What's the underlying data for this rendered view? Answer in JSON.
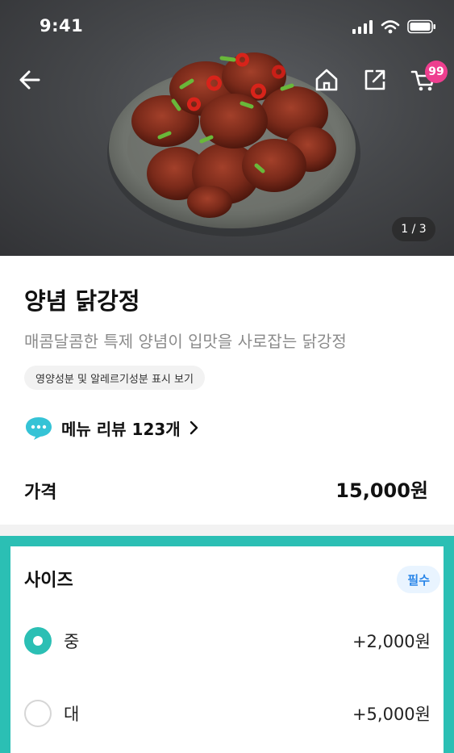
{
  "status_bar": {
    "time": "9:41"
  },
  "hero": {
    "image_counter": "1 / 3",
    "cart_count": "99"
  },
  "product": {
    "name": "양념 닭강정",
    "description": "매콤달콤한 특제 양념이 입맛을 사로잡는 닭강정",
    "nutrition_link": "영양성분 및 알레르기성분 표시 보기",
    "review_link": "메뉴 리뷰 123개"
  },
  "price": {
    "label": "가격",
    "value": "15,000원"
  },
  "size_option": {
    "title": "사이즈",
    "required_badge": "필수",
    "choices": [
      {
        "label": "중",
        "price": "+2,000원",
        "selected": true
      },
      {
        "label": "대",
        "price": "+5,000원",
        "selected": false
      }
    ]
  },
  "colors": {
    "accent": "#2bbfb4",
    "badge_pink": "#ee3f8f",
    "required_text": "#2a86e8",
    "required_bg": "#e9f4ff"
  },
  "icons": [
    "signal-icon",
    "wifi-icon",
    "battery-icon",
    "back-arrow-icon",
    "home-icon",
    "share-icon",
    "cart-icon",
    "speech-bubble-icon",
    "chevron-right-icon"
  ]
}
